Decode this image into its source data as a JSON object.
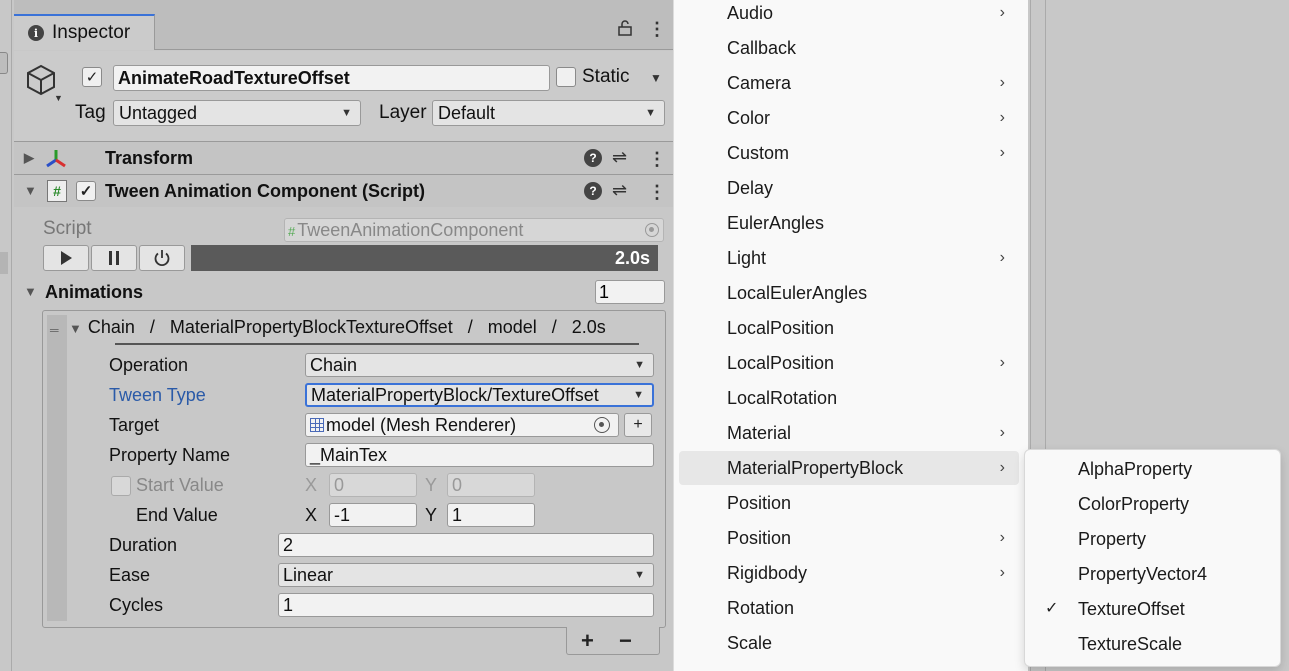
{
  "inspector": {
    "tab_label": "Inspector",
    "object_name": "AnimateRoadTextureOffset",
    "static_label": "Static",
    "tag_label": "Tag",
    "tag_value": "Untagged",
    "layer_label": "Layer",
    "layer_value": "Default",
    "components": {
      "transform": {
        "title": "Transform"
      },
      "tween": {
        "title": "Tween Animation Component (Script)"
      }
    },
    "script_label": "Script",
    "script_value": "TweenAnimationComponent",
    "progress_label": "2.0s",
    "progress_fraction": 1.0,
    "animations_label": "Animations",
    "animations_count": "1",
    "element_header": "Chain   /   MaterialPropertyBlockTextureOffset   /   model   /   2.0s",
    "props": {
      "operation_label": "Operation",
      "operation_value": "Chain",
      "tween_type_label": "Tween Type",
      "tween_type_value": "MaterialPropertyBlock/TextureOffset",
      "target_label": "Target",
      "target_value": "model (Mesh Renderer)",
      "target_add": "+",
      "property_name_label": "Property Name",
      "property_name_value": "_MainTex",
      "start_value_label": "Start Value",
      "start_x": "0",
      "start_y": "0",
      "end_value_label": "End Value",
      "end_x": "-1",
      "end_y": "1",
      "x_label": "X",
      "y_label": "Y",
      "duration_label": "Duration",
      "duration_value": "2",
      "ease_label": "Ease",
      "ease_value": "Linear",
      "cycles_label": "Cycles",
      "cycles_value": "1"
    },
    "list_add": "+",
    "list_remove": "−"
  },
  "menu": {
    "items": [
      {
        "label": "Audio",
        "submenu": true
      },
      {
        "label": "Callback",
        "submenu": false
      },
      {
        "label": "Camera",
        "submenu": true
      },
      {
        "label": "Color",
        "submenu": true
      },
      {
        "label": "Custom",
        "submenu": true
      },
      {
        "label": "Delay",
        "submenu": false
      },
      {
        "label": "EulerAngles",
        "submenu": false
      },
      {
        "label": "Light",
        "submenu": true
      },
      {
        "label": "LocalEulerAngles",
        "submenu": false
      },
      {
        "label": "LocalPosition",
        "submenu": false
      },
      {
        "label": "LocalPosition",
        "submenu": true
      },
      {
        "label": "LocalRotation",
        "submenu": false
      },
      {
        "label": "Material",
        "submenu": true
      },
      {
        "label": "MaterialPropertyBlock",
        "submenu": true,
        "highlighted": true
      },
      {
        "label": "Position",
        "submenu": false
      },
      {
        "label": "Position",
        "submenu": true
      },
      {
        "label": "Rigidbody",
        "submenu": true
      },
      {
        "label": "Rotation",
        "submenu": false
      },
      {
        "label": "Scale",
        "submenu": false
      }
    ]
  },
  "submenu": {
    "items": [
      {
        "label": "AlphaProperty",
        "checked": false
      },
      {
        "label": "ColorProperty",
        "checked": false
      },
      {
        "label": "Property",
        "checked": false
      },
      {
        "label": "PropertyVector4",
        "checked": false
      },
      {
        "label": "TextureOffset",
        "checked": true
      },
      {
        "label": "TextureScale",
        "checked": false
      }
    ]
  },
  "icons": {
    "info": "info-icon",
    "lock": "lock-icon",
    "kebab": "kebab-menu-icon",
    "gameobject": "cube-icon",
    "transform": "transform-axes-icon",
    "script": "script-hash-icon",
    "help": "help-icon",
    "presets": "presets-sliders-icon",
    "play": "play-icon",
    "pause": "pause-icon",
    "power": "power-icon",
    "chevron": "chevron-right-icon",
    "check": "checkmark-icon"
  },
  "colors": {
    "accent": "#3a72d8",
    "label_highlight": "#2a5aa8",
    "progress_bar": "#5a5a5a"
  }
}
